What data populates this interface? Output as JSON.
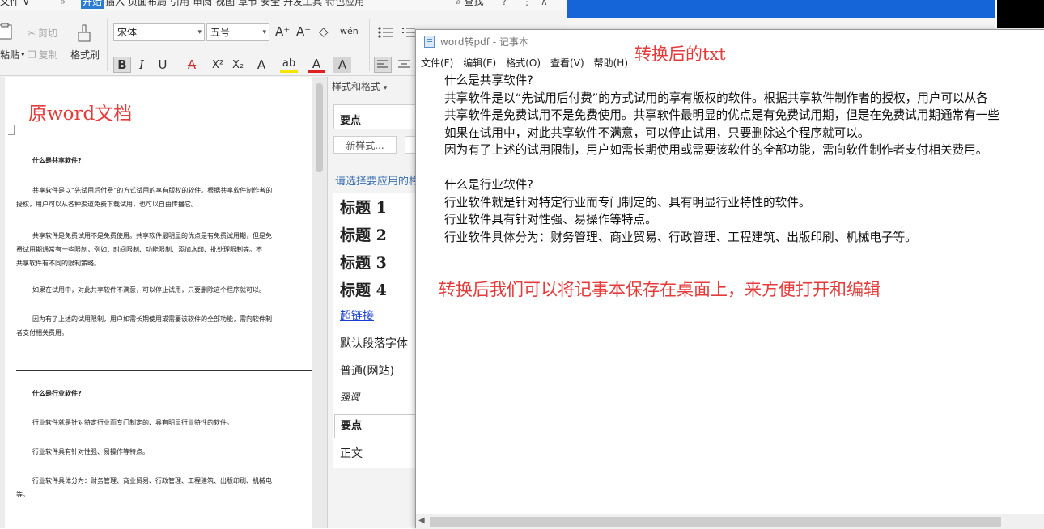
{
  "wps": {
    "menu": {
      "file": "文件",
      "file_arrow": "∨",
      "more": "»",
      "tabs": [
        "开始",
        "插入",
        "页面布局",
        "引用",
        "审阅",
        "视图",
        "章节",
        "安全",
        "开发工具",
        "特色应用"
      ],
      "active_tab": "开始",
      "find": "查找",
      "help": "?",
      "more_btn": "⋮",
      "up": "∧"
    },
    "ribbon": {
      "paste": "粘贴",
      "cut": "剪切",
      "copy": "复制",
      "format_painter": "格式刷",
      "font_name": "宋体",
      "font_size": "五号",
      "grow": "A⁺",
      "shrink": "A⁻",
      "clear": "◇",
      "phonetic": "wén",
      "bold": "B",
      "italic": "I",
      "underline": "U",
      "strike": "A",
      "superscript": "X²",
      "subscript": "X₂",
      "text_effect": "A",
      "highlight": "ab",
      "font_color": "A",
      "char_shading": "A"
    },
    "annotation": "原word文档",
    "document": [
      {
        "kind": "heading",
        "text": "什么是共享软件?"
      },
      {
        "kind": "para",
        "lines": [
          "共享软件是以“先试用后付费”的方式试用的享有版权的软件。根据共享软件制作者的",
          "授权，用户可以从各种渠道免费下载试用，也可以自由传播它。"
        ]
      },
      {
        "kind": "para",
        "lines": [
          "共享软件是免费试用不是免费使用。共享软件最明显的优点是有免费试用期，但是免",
          "费试用期通常有一些限制，例如：时间限制、功能限制、添加水印、批处理限制等。不",
          "共享软件有不同的限制策略。"
        ]
      },
      {
        "kind": "para",
        "lines": [
          "如果在试用中，对此共享软件不满意，可以停止试用，只要删除这个程序就可以。"
        ]
      },
      {
        "kind": "para",
        "lines": [
          "因为有了上述的试用限制，用户如需长期使用或需要该软件的全部功能，需向软件制",
          "者支付相关费用。"
        ]
      },
      {
        "kind": "heading",
        "text": "什么是行业软件?"
      },
      {
        "kind": "para",
        "lines": [
          "行业软件就是针对特定行业而专门制定的、具有明显行业特性的软件。"
        ]
      },
      {
        "kind": "para",
        "lines": [
          "行业软件具有针对性强、易操作等特点。"
        ]
      },
      {
        "kind": "para",
        "lines": [
          "行业软件具体分为：财务管理、商业贸易、行政管理、工程建筑、出版印刷、机械电",
          "等。"
        ]
      }
    ],
    "styles_pane": {
      "title": "样式和格式",
      "current_style": "要点",
      "new_style": "新样式...",
      "hint": "请选择要应用的格式",
      "items": [
        {
          "label": "标题 1",
          "kind": "h"
        },
        {
          "label": "标题 2",
          "kind": "h"
        },
        {
          "label": "标题 3",
          "kind": "h"
        },
        {
          "label": "标题 4",
          "kind": "h"
        },
        {
          "label": "超链接",
          "kind": "link"
        },
        {
          "label": "默认段落字体",
          "kind": "n"
        },
        {
          "label": "普通(网站)",
          "kind": "n"
        },
        {
          "label": "强调",
          "kind": "i"
        },
        {
          "label": "要点",
          "kind": "sel"
        },
        {
          "label": "正文",
          "kind": "n"
        }
      ]
    }
  },
  "notepad": {
    "title": "word转pdf - 记事本",
    "menu": [
      "文件(F)",
      "编辑(E)",
      "格式(O)",
      "查看(V)",
      "帮助(H)"
    ],
    "annotation_title": "转换后的txt",
    "annotation_body": "转换后我们可以将记事本保存在桌面上，来方便打开和编辑",
    "lines": [
      "什么是共享软件?",
      "共享软件是以“先试用后付费”的方式试用的享有版权的软件。根据共享软件制作者的授权，用户可以从各",
      "共享软件是免费试用不是免费使用。共享软件最明显的优点是有免费试用期，但是在免费试用期通常有一些",
      "如果在试用中，对此共享软件不满意，可以停止试用，只要删除这个程序就可以。",
      "因为有了上述的试用限制，用户如需长期使用或需要该软件的全部功能，需向软件制作者支付相关费用。",
      "",
      "什么是行业软件?",
      "行业软件就是针对特定行业而专门制定的、具有明显行业特性的软件。",
      "行业软件具有针对性强、易操作等特点。",
      "行业软件具体分为：财务管理、商业贸易、行政管理、工程建筑、出版印刷、机械电子等。"
    ]
  }
}
